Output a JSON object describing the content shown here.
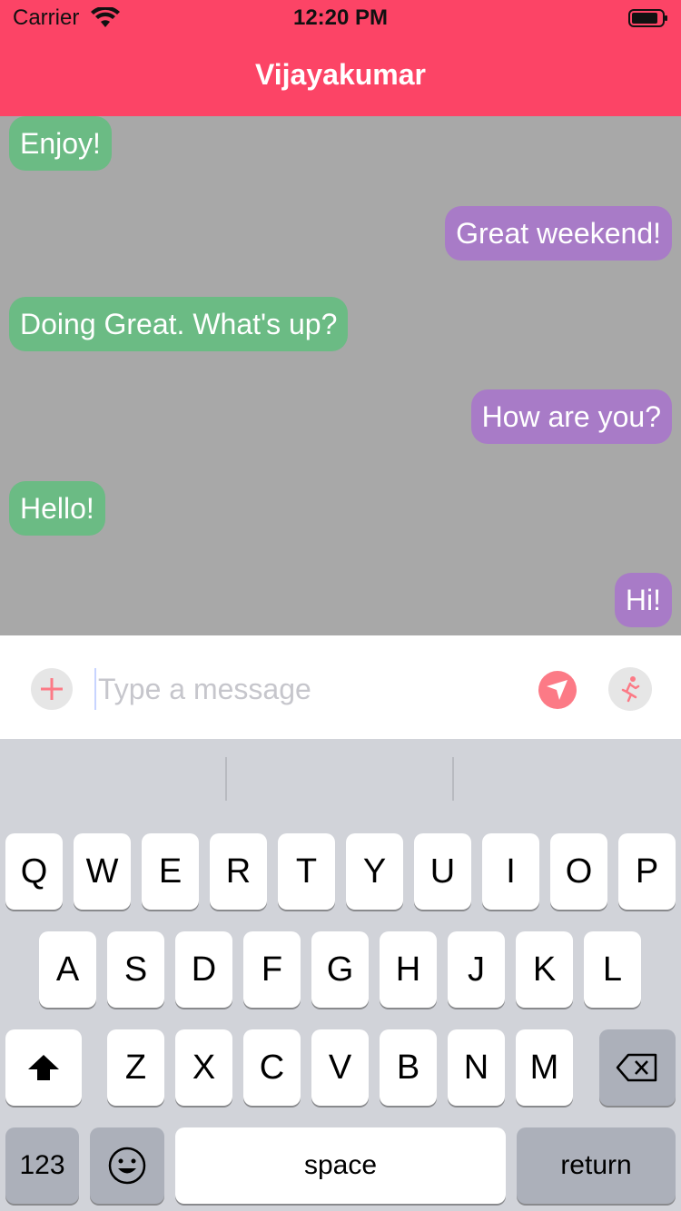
{
  "status_bar": {
    "carrier": "Carrier",
    "time": "12:20 PM"
  },
  "header": {
    "title": "Vijayakumar"
  },
  "colors": {
    "header": "#fc4466",
    "chat_bg": "#a8a8a8",
    "incoming": "#6bbb84",
    "outgoing": "#a87bc7",
    "accent_icon": "#fc7a86"
  },
  "messages": [
    {
      "direction": "incoming",
      "text": "Enjoy!"
    },
    {
      "direction": "outgoing",
      "text": "Great weekend!"
    },
    {
      "direction": "incoming",
      "text": "Doing Great. What's up?"
    },
    {
      "direction": "outgoing",
      "text": "How are you?"
    },
    {
      "direction": "incoming",
      "text": "Hello!"
    },
    {
      "direction": "outgoing",
      "text": "Hi!"
    }
  ],
  "composer": {
    "placeholder": "Type a message",
    "value": "",
    "add_icon": "plus-icon",
    "send_icon": "send-icon",
    "extra_icon": "running-person-icon"
  },
  "keyboard": {
    "row1": [
      "Q",
      "W",
      "E",
      "R",
      "T",
      "Y",
      "U",
      "I",
      "O",
      "P"
    ],
    "row2": [
      "A",
      "S",
      "D",
      "F",
      "G",
      "H",
      "J",
      "K",
      "L"
    ],
    "row3": [
      "Z",
      "X",
      "C",
      "V",
      "B",
      "N",
      "M"
    ],
    "numbers_label": "123",
    "space_label": "space",
    "return_label": "return",
    "shift_icon": "shift-icon",
    "delete_icon": "backspace-icon",
    "emoji_icon": "emoji-icon"
  }
}
